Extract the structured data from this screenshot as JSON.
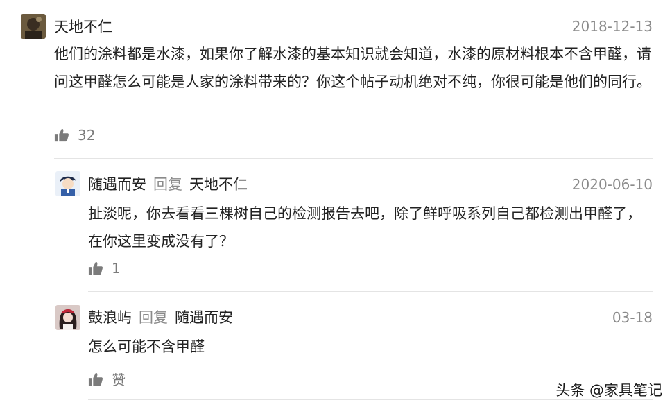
{
  "comments": [
    {
      "author": "天地不仁",
      "date": "2018-12-13",
      "text": "他们的涂料都是水漆，如果你了解水漆的基本知识就会知道，水漆的原材料根本不含甲醛，请问这甲醛怎么可能是人家的涂料带来的？你这个帖子动机绝对不纯，你很可能是他们的同行。",
      "likes": "32",
      "avatar_icon": "brown-portrait-avatar"
    },
    {
      "author": "随遇而安",
      "reply_word": "回复",
      "reply_to": "天地不仁",
      "date": "2020-06-10",
      "text": "扯淡呢，你去看看三棵树自己的检测报告去吧，除了鲜呼吸系列自己都检测出甲醛了，在你这里变成没有了？",
      "likes": "1",
      "avatar_icon": "anime-boy-avatar"
    },
    {
      "author": "鼓浪屿",
      "reply_word": "回复",
      "reply_to": "随遇而安",
      "date": "03-18",
      "text": "怎么可能不含甲醛",
      "likes": "赞",
      "avatar_icon": "girl-portrait-avatar"
    }
  ],
  "watermark": "头条 @家具笔记",
  "colors": {
    "meta_gray": "#8a8a8a",
    "text": "#222222",
    "divider": "#e4e4e4"
  }
}
